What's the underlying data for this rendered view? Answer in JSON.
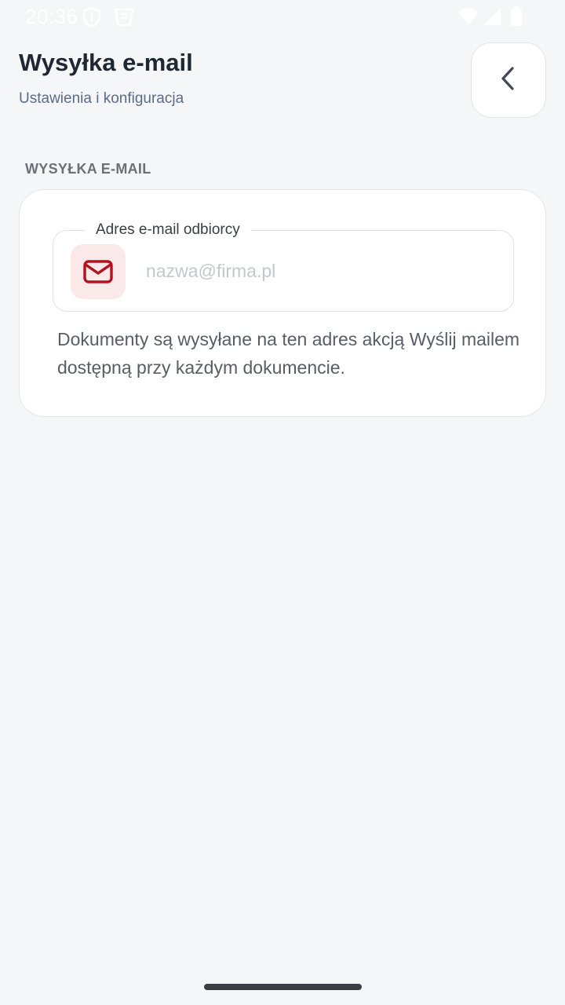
{
  "status_bar": {
    "time": "20:36",
    "icons": [
      "shield-icon",
      "app-notification-icon",
      "wifi-icon",
      "signal-icon",
      "battery-icon"
    ]
  },
  "header": {
    "title": "Wysyłka e-mail",
    "subtitle": "Ustawienia i konfiguracja",
    "back_icon": "chevron-left-icon"
  },
  "section": {
    "label": "WYSYŁKA E-MAIL"
  },
  "email_field": {
    "label": "Adres e-mail odbiorcy",
    "placeholder": "nazwa@firma.pl",
    "value": "",
    "icon": "mail-icon"
  },
  "help_text": "Dokumenty są wysyłane na ten adres akcją Wyślij mailem dostępną przy każdym dokumencie.",
  "colors": {
    "background": "#f5f6f8",
    "card": "#ffffff",
    "accent": "#b3121f",
    "accent_bg": "#fbe9ea",
    "title": "#1f2733",
    "subtitle": "#5c6b86"
  }
}
